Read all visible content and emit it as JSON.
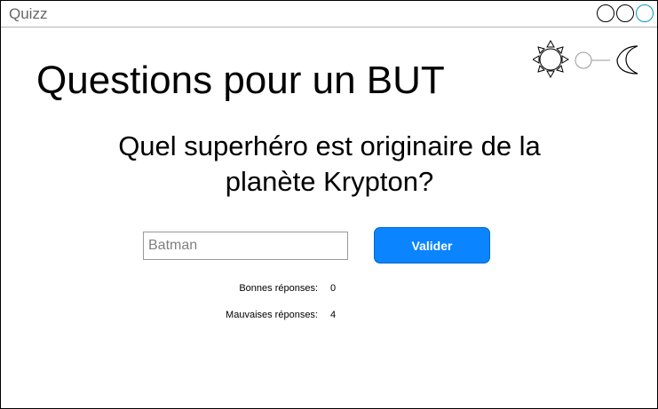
{
  "window": {
    "title": "Quizz",
    "controls": [
      "minimize-button",
      "maximize-button",
      "close-button"
    ],
    "accent_color": "#0099cc"
  },
  "theme_toggle": {
    "left_icon": "sun-icon",
    "right_icon": "moon-icon",
    "state": "light"
  },
  "page": {
    "title": "Questions pour un BUT"
  },
  "quiz": {
    "question": "Quel superhéro est originaire de la planète Krypton?",
    "answer_placeholder": "Batman",
    "answer_value": "",
    "submit_label": "Valider",
    "submit_color": "#0a84ff"
  },
  "score": {
    "good_label": "Bonnes réponses:",
    "good_value": "0",
    "bad_label": "Mauvaises réponses:",
    "bad_value": "4"
  }
}
